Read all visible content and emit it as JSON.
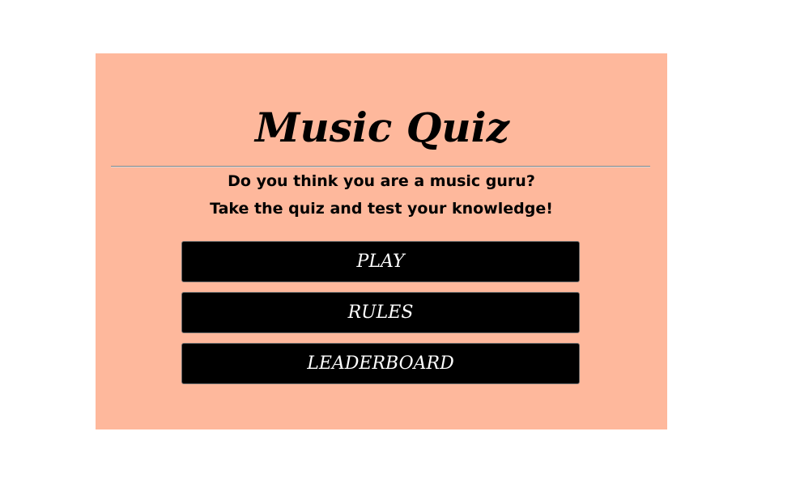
{
  "page": {
    "title": "Music Quiz",
    "subtitle_line1": "Do you think you are a music guru?",
    "subtitle_line2": "Take the quiz and test your knowledge!"
  },
  "menu": {
    "play_label": "PLAY",
    "rules_label": "RULES",
    "leaderboard_label": "LEADERBOARD"
  },
  "colors": {
    "card_background": "#FEB89C",
    "button_background": "#000000",
    "button_text": "#FFFFFF"
  }
}
